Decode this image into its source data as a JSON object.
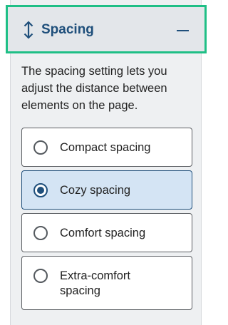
{
  "accordion": {
    "title": "Spacing",
    "description": "The spacing setting lets you adjust the distance between elements on the page.",
    "expanded": true,
    "icon": "vertical-arrows-icon",
    "collapse_icon": "minus-icon"
  },
  "options": [
    {
      "label": "Compact spacing",
      "selected": false
    },
    {
      "label": "Cozy spacing",
      "selected": true
    },
    {
      "label": "Comfort spacing",
      "selected": false
    },
    {
      "label": "Extra-comfort spacing",
      "selected": false
    }
  ],
  "colors": {
    "accent": "#1f4f7b",
    "focus_ring": "#1fbf86",
    "selected_bg": "#d4e4f4"
  }
}
